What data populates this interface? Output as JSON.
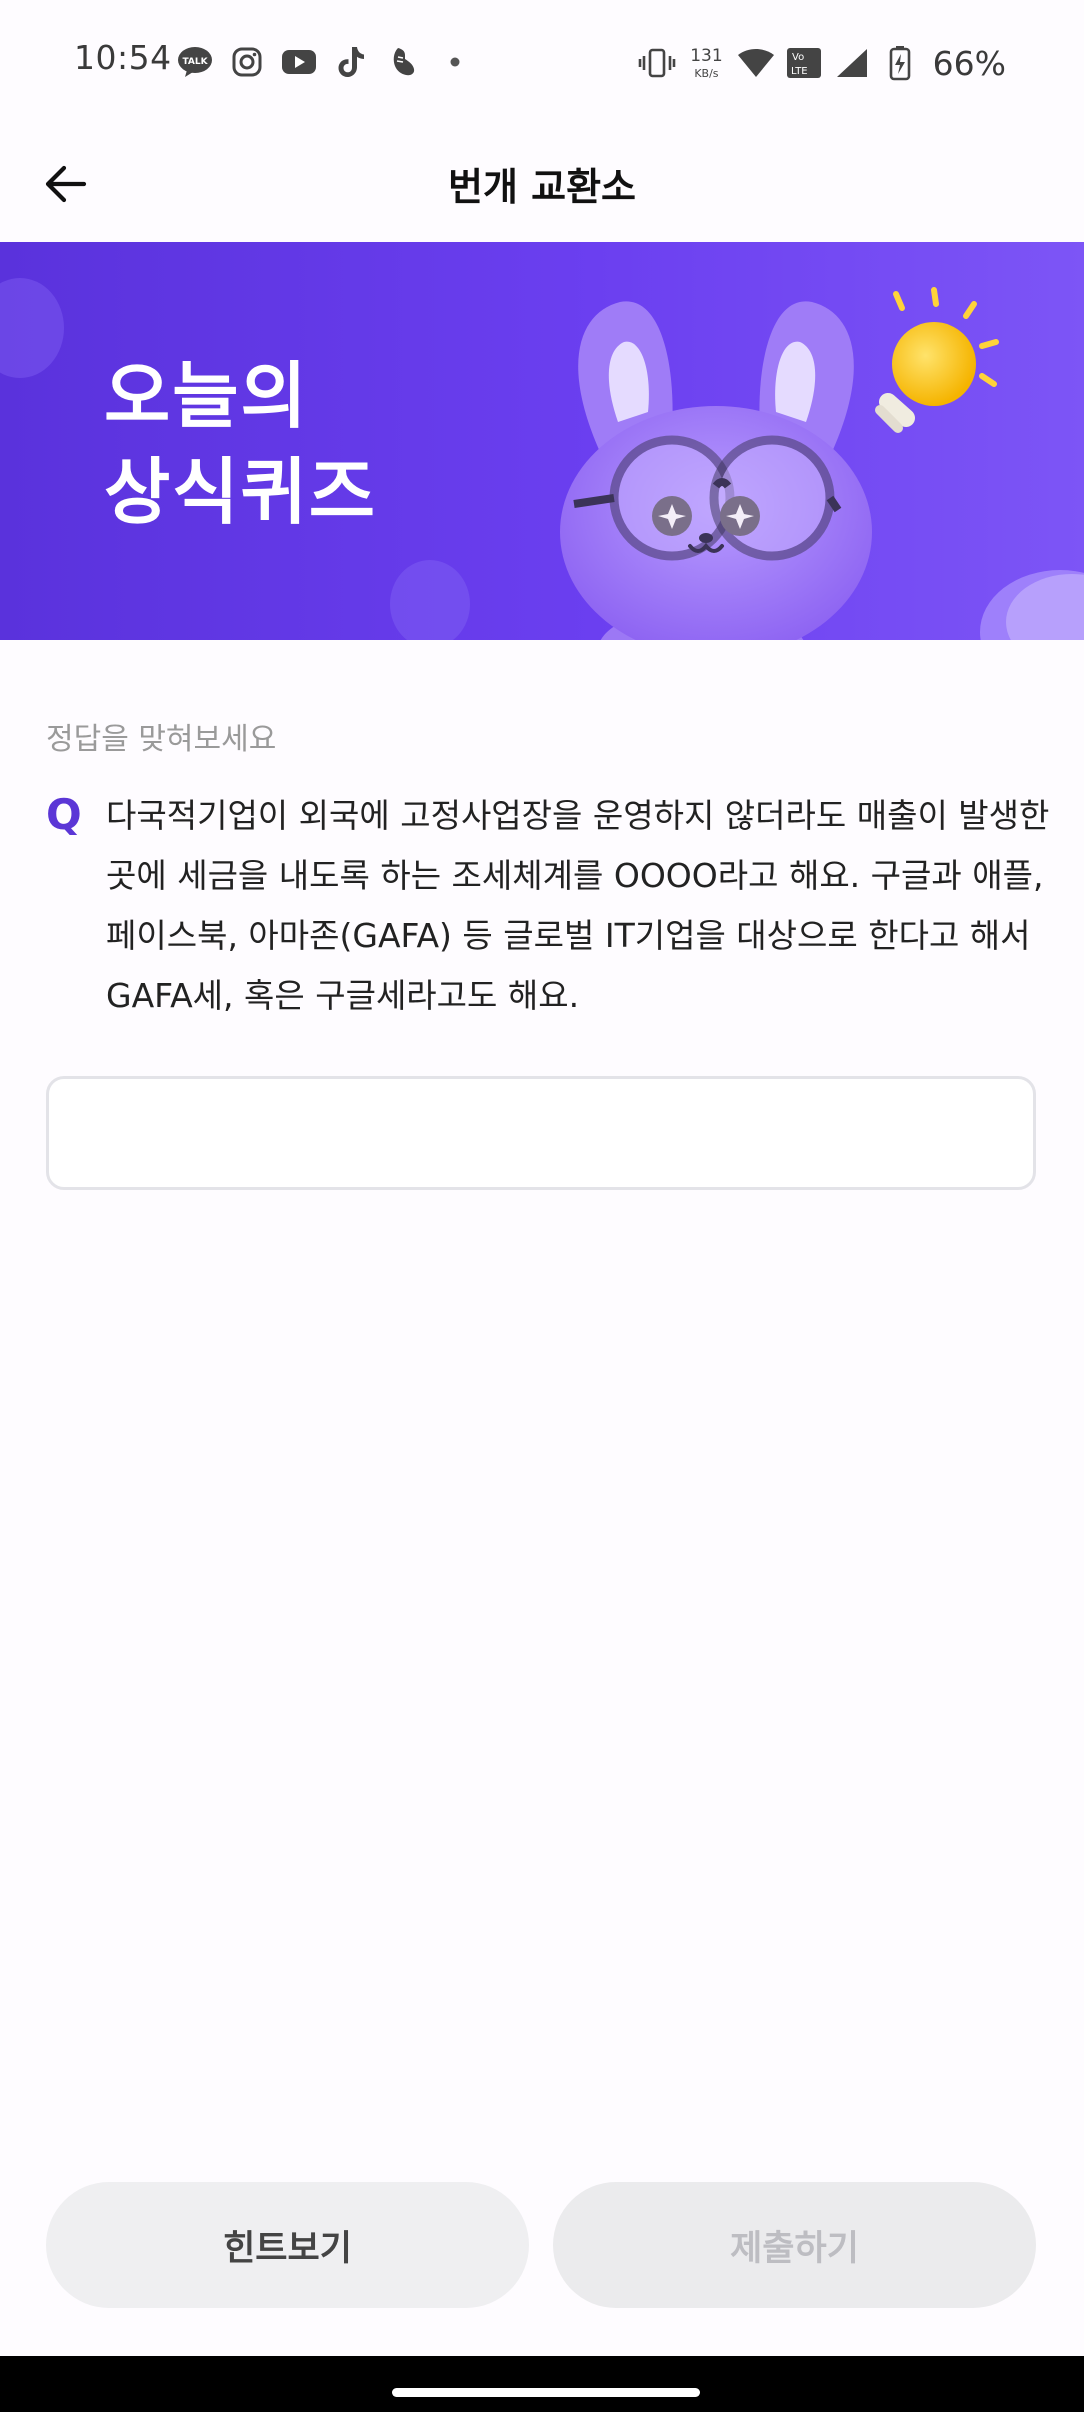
{
  "status_bar": {
    "time": "10:54",
    "net_speed_value": "131",
    "net_speed_unit": "KB/s",
    "battery_percent": "66%",
    "left_icons": [
      "kakaotalk-icon",
      "instagram-icon",
      "youtube-icon",
      "tiktok-icon",
      "shoe-icon",
      "dot-icon"
    ],
    "right_icons": [
      "vibrate-icon",
      "wifi-icon",
      "volte-icon",
      "signal-icon",
      "battery-charging-icon"
    ]
  },
  "header": {
    "title": "번개 교환소",
    "back_icon": "arrow-left-icon"
  },
  "banner": {
    "title_line1": "오늘의",
    "title_line2": "상식퀴즈",
    "background_color": "#6b3ff0"
  },
  "quiz": {
    "instruction": "정답을 맞혀보세요",
    "q_mark": "Q",
    "question": "다국적기업이 외국에 고정사업장을 운영하지 않더라도 매출이 발생한 곳에 세금을 내도록 하는 조세체계를 OOOO라고 해요. 구글과 애플, 페이스북, 아마존(GAFA) 등 글로벌 IT기업을 대상으로 한다고 해서 GAFA세, 혹은 구글세라고도 해요.",
    "answer_value": "",
    "answer_placeholder": ""
  },
  "buttons": {
    "hint_label": "힌트보기",
    "submit_label": "제출하기"
  },
  "colors": {
    "accent": "#5b36d6",
    "banner": "#6b3ff0",
    "button_bg": "#eeeff1",
    "submit_disabled_text": "#bdbdc2"
  }
}
